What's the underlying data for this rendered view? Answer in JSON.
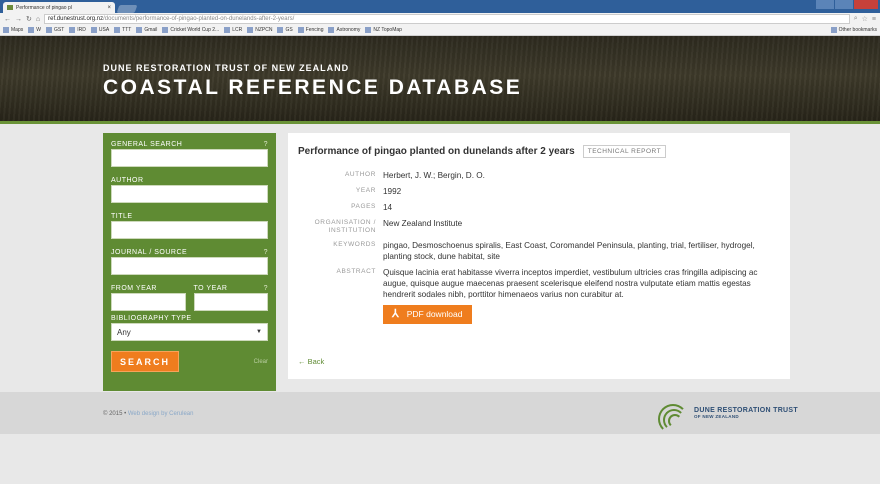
{
  "browser": {
    "tab_title": "Performance of pingao pl",
    "tab_close": "×",
    "url_host": "ref.dunestrust.org.nz",
    "url_path": "/documents/performance-of-pingao-planted-on-dunelands-after-2-years/",
    "bookmarks": [
      "Maps",
      "W",
      "GST",
      "IRD",
      "USA",
      "TTT",
      "Gmail",
      "Cricket World Cup 2...",
      "LCR",
      "NZPCN",
      "GS",
      "Fencing",
      "Astronomy",
      "NZ TopoMap"
    ],
    "other_bookmarks": "Other bookmarks"
  },
  "hero": {
    "subtitle": "DUNE RESTORATION TRUST OF NEW ZEALAND",
    "title": "COASTAL REFERENCE DATABASE"
  },
  "sidebar": {
    "general_search": "GENERAL SEARCH",
    "help": "?",
    "author": "AUTHOR",
    "title": "TITLE",
    "journal": "JOURNAL / SOURCE",
    "from_year": "FROM YEAR",
    "to_year": "TO YEAR",
    "bibliography_type": "BIBLIOGRAPHY TYPE",
    "bibliography_value": "Any",
    "search_button": "SEARCH",
    "clear": "Clear"
  },
  "record": {
    "title": "Performance of pingao planted on dunelands after 2 years",
    "type": "TECHNICAL REPORT",
    "labels": {
      "author": "AUTHOR",
      "year": "YEAR",
      "pages": "PAGES",
      "organisation": "ORGANISATION / INSTITUTION",
      "keywords": "KEYWORDS",
      "abstract": "ABSTRACT"
    },
    "author": "Herbert, J. W.; Bergin, D. O.",
    "year": "1992",
    "pages": "14",
    "organisation": "New Zealand Institute",
    "keywords": "pingao, Desmoschoenus spiralis, East Coast, Coromandel Peninsula, planting, trial, fertiliser, hydrogel, planting stock, dune habitat, site",
    "abstract": "Quisque lacinia erat habitasse viverra inceptos imperdiet, vestibulum ultricies cras fringilla adipiscing ac augue, quisque augue maecenas praesent scelerisque eleifend nostra vulputate etiam mattis egestas hendrerit sodales nibh, porttitor himenaeos varius non curabitur at.",
    "pdf_button": "PDF download",
    "back": "← Back"
  },
  "footer": {
    "copyright": "© 2015  •  ",
    "credit": "Web design by Cerulean",
    "logo_line1": "DUNE RESTORATION TRUST",
    "logo_line2": "OF NEW ZEALAND"
  },
  "colors": {
    "brand_green": "#5f8b33",
    "accent_orange": "#ef7d1e",
    "logo_blue": "#2f4f75"
  }
}
